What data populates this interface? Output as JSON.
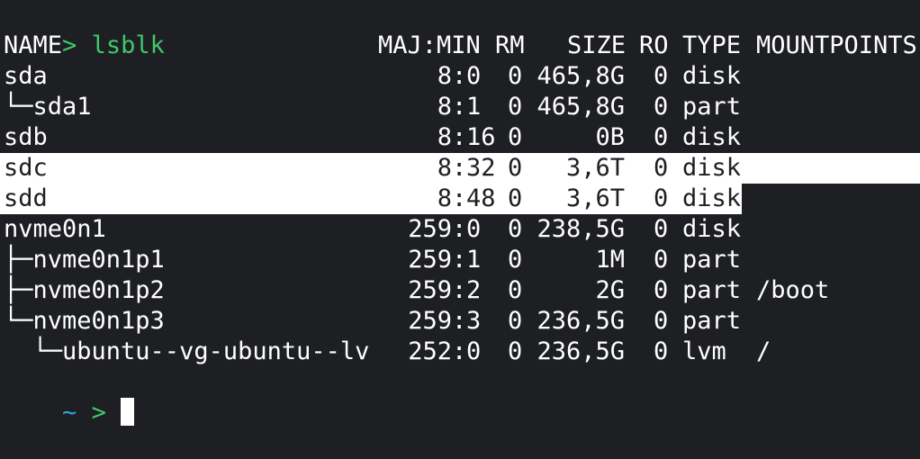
{
  "command": {
    "prompt_arrow": ">",
    "text": "lsblk"
  },
  "headers": {
    "name": "NAME",
    "majmin": "MAJ:MIN",
    "rm": "RM",
    "size": "SIZE",
    "ro": "RO",
    "type": "TYPE",
    "mountpoints": "MOUNTPOINTS"
  },
  "rows": [
    {
      "name": "sda",
      "maj": "8",
      "min": "0",
      "rm": "0",
      "size": "465,8G",
      "ro": "0",
      "type": "disk",
      "mount": ""
    },
    {
      "name": "└─sda1",
      "maj": "8",
      "min": "1",
      "rm": "0",
      "size": "465,8G",
      "ro": "0",
      "type": "part",
      "mount": ""
    },
    {
      "name": "sdb",
      "maj": "8",
      "min": "16",
      "rm": "0",
      "size": "0B",
      "ro": "0",
      "type": "disk",
      "mount": ""
    },
    {
      "name": "sdc",
      "maj": "8",
      "min": "32",
      "rm": "0",
      "size": "3,6T",
      "ro": "0",
      "type": "disk",
      "mount": ""
    },
    {
      "name": "sdd",
      "maj": "8",
      "min": "48",
      "rm": "0",
      "size": "3,6T",
      "ro": "0",
      "type": "disk",
      "mount": ""
    },
    {
      "name": "nvme0n1",
      "maj": "259",
      "min": "0",
      "rm": "0",
      "size": "238,5G",
      "ro": "0",
      "type": "disk",
      "mount": ""
    },
    {
      "name": "├─nvme0n1p1",
      "maj": "259",
      "min": "1",
      "rm": "0",
      "size": "1M",
      "ro": "0",
      "type": "part",
      "mount": ""
    },
    {
      "name": "├─nvme0n1p2",
      "maj": "259",
      "min": "2",
      "rm": "0",
      "size": "2G",
      "ro": "0",
      "type": "part",
      "mount": "/boot"
    },
    {
      "name": "└─nvme0n1p3",
      "maj": "259",
      "min": "3",
      "rm": "0",
      "size": "236,5G",
      "ro": "0",
      "type": "part",
      "mount": ""
    },
    {
      "name": "  └─ubuntu--vg-ubuntu--lv",
      "maj": "252",
      "min": "0",
      "rm": "0",
      "size": "236,5G",
      "ro": "0",
      "type": "lvm",
      "mount": "/"
    }
  ],
  "prompt": {
    "tilde": "~",
    "arrow": ">"
  },
  "colors": {
    "background": "#1e1f22",
    "prompt_green": "#3fc86a",
    "tilde_blue": "#2aa7e8",
    "selection": "#ffffff"
  }
}
